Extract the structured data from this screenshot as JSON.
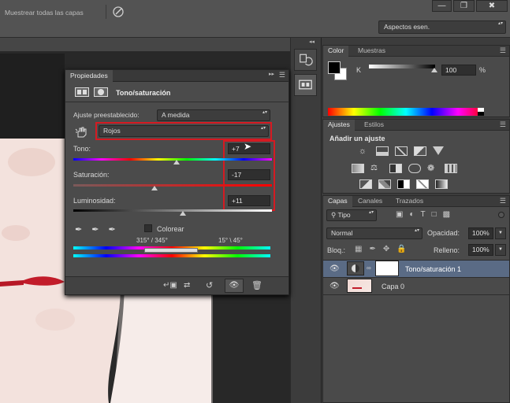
{
  "window": {
    "minimize_glyph": "—",
    "restore_glyph": "❐",
    "close_glyph": "✖"
  },
  "options_bar": {
    "sample_all_layers": "Muestrear todas las capas",
    "workspace": "Aspectos esen."
  },
  "dock": {
    "collapse_glyph": "◂◂",
    "history_icon": "history-icon",
    "properties_icon": "properties-icon"
  },
  "color_panel": {
    "tabs": [
      "Color",
      "Muestras"
    ],
    "channel_label": "K",
    "channel_value": "100",
    "channel_unit": "%"
  },
  "adjustments_panel": {
    "tabs": [
      "Ajustes",
      "Estilos"
    ],
    "heading": "Añadir un ajuste"
  },
  "layers_panel": {
    "tabs": [
      "Capas",
      "Canales",
      "Trazados"
    ],
    "filter_kind": "Tipo",
    "blend_mode": "Normal",
    "opacity_label": "Opacidad:",
    "opacity_value": "100%",
    "lock_label": "Bloq.:",
    "fill_label": "Relleno:",
    "fill_value": "100%",
    "layers": [
      {
        "name": "Tono/saturación 1",
        "selected": true
      },
      {
        "name": "Capa 0",
        "selected": false
      }
    ]
  },
  "properties_panel": {
    "tab_label": "Propiedades",
    "title": "Tono/saturación",
    "preset_label": "Ajuste preestablecido:",
    "preset_value": "A medida",
    "channel_value": "Rojos",
    "hue": {
      "label": "Tono:",
      "value": "+7",
      "position": 0.52
    },
    "saturation": {
      "label": "Saturación:",
      "value": "-17",
      "position": 0.41
    },
    "lightness": {
      "label": "Luminosidad:",
      "value": "+11",
      "position": 0.55
    },
    "colorize_label": "Colorear",
    "range_left": "315° / 345°",
    "range_right": "15° \\ 45°"
  },
  "colors": {
    "highlight": "#d51a22",
    "selected_layer": "#5a6b85"
  }
}
